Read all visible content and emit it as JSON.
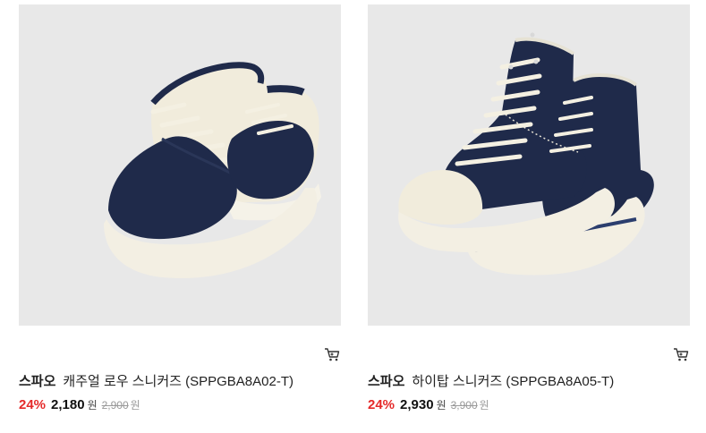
{
  "products": [
    {
      "brand": "스파오",
      "name": "캐주얼 로우 스니커즈 (SPPGBA8A02-T)",
      "discount": "24%",
      "price": "2,180",
      "price_unit": "원",
      "original_price": "2,900",
      "original_unit": "원",
      "image": "navy-ivory-low-top-sneakers",
      "cart_icon": "cart-icon"
    },
    {
      "brand": "스파오",
      "name": "하이탑 스니커즈 (SPPGBA8A05-T)",
      "discount": "24%",
      "price": "2,930",
      "price_unit": "원",
      "original_price": "3,900",
      "original_unit": "원",
      "image": "navy-high-top-canvas-sneakers",
      "cart_icon": "cart-icon"
    }
  ],
  "colors": {
    "discount": "#e52a2a",
    "image_bg": "#e8e8e8",
    "navy": "#1f2a4a",
    "ivory": "#f1ecdc"
  }
}
